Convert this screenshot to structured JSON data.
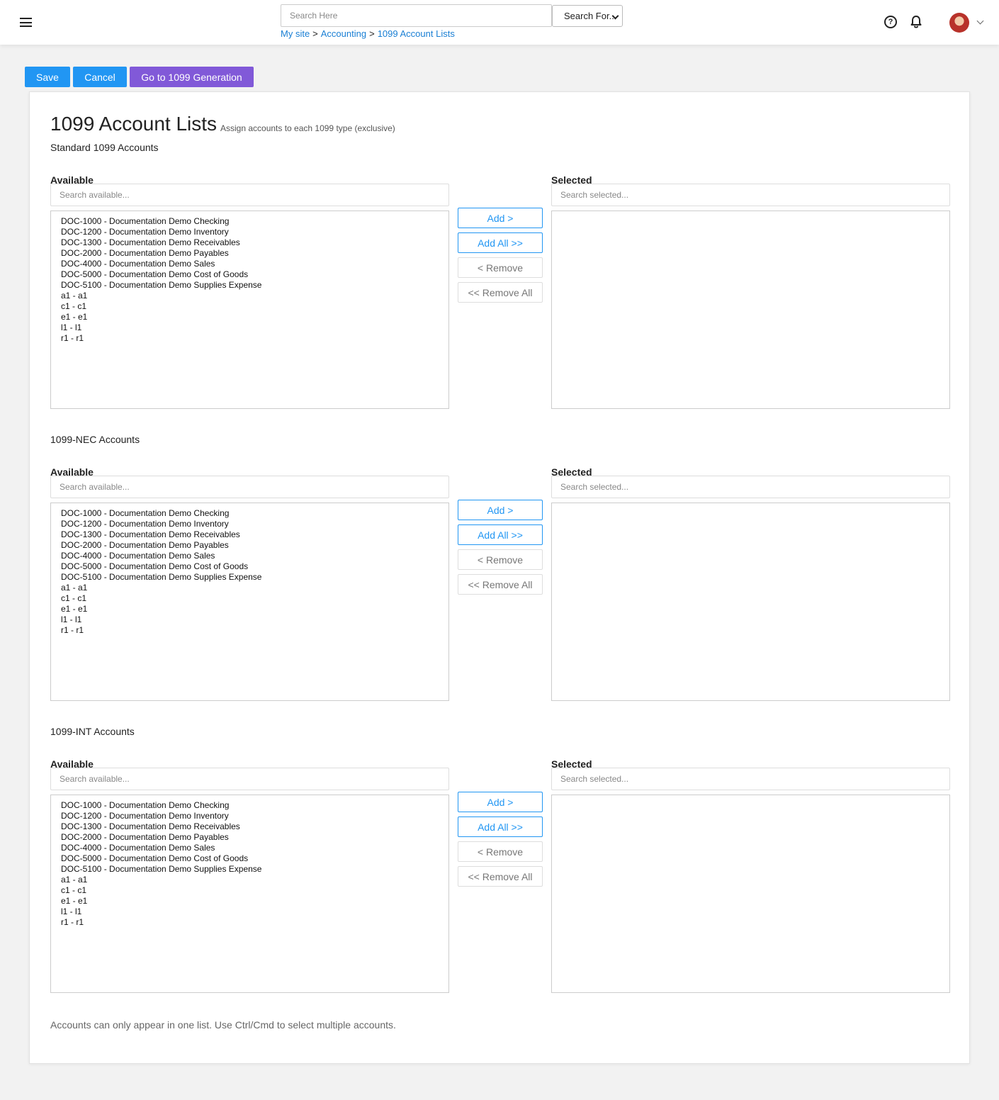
{
  "header": {
    "search_placeholder": "Search Here",
    "search_for_label": "Search For...",
    "breadcrumb": [
      "My site",
      "Accounting",
      "1099 Account Lists"
    ],
    "breadcrumb_sep": ">",
    "help_glyph": "?"
  },
  "toolbar": {
    "save_label": "Save",
    "cancel_label": "Cancel",
    "generation_label": "Go to 1099 Generation"
  },
  "page": {
    "title": "1099 Account Lists",
    "subtitle": "Assign accounts to each 1099 type (exclusive)",
    "footnote": "Accounts can only appear in one list. Use Ctrl/Cmd to select multiple accounts."
  },
  "common": {
    "available_label": "Available",
    "selected_label": "Selected",
    "available_placeholder": "Search available...",
    "selected_placeholder": "Search selected...",
    "add_label": "Add >",
    "add_all_label": "Add All >>",
    "remove_label": "< Remove",
    "remove_all_label": "<< Remove All"
  },
  "sections": [
    {
      "title": "Standard 1099 Accounts",
      "available": [
        "DOC-1000 - Documentation Demo Checking",
        "DOC-1200 - Documentation Demo Inventory",
        "DOC-1300 - Documentation Demo Receivables",
        "DOC-2000 - Documentation Demo Payables",
        "DOC-4000 - Documentation Demo Sales",
        "DOC-5000 - Documentation Demo Cost of Goods",
        "DOC-5100 - Documentation Demo Supplies Expense",
        "a1 - a1",
        "c1 - c1",
        "e1 - e1",
        "l1 - l1",
        "r1 - r1"
      ],
      "selected": []
    },
    {
      "title": "1099-NEC Accounts",
      "available": [
        "DOC-1000 - Documentation Demo Checking",
        "DOC-1200 - Documentation Demo Inventory",
        "DOC-1300 - Documentation Demo Receivables",
        "DOC-2000 - Documentation Demo Payables",
        "DOC-4000 - Documentation Demo Sales",
        "DOC-5000 - Documentation Demo Cost of Goods",
        "DOC-5100 - Documentation Demo Supplies Expense",
        "a1 - a1",
        "c1 - c1",
        "e1 - e1",
        "l1 - l1",
        "r1 - r1"
      ],
      "selected": []
    },
    {
      "title": "1099-INT Accounts",
      "available": [
        "DOC-1000 - Documentation Demo Checking",
        "DOC-1200 - Documentation Demo Inventory",
        "DOC-1300 - Documentation Demo Receivables",
        "DOC-2000 - Documentation Demo Payables",
        "DOC-4000 - Documentation Demo Sales",
        "DOC-5000 - Documentation Demo Cost of Goods",
        "DOC-5100 - Documentation Demo Supplies Expense",
        "a1 - a1",
        "c1 - c1",
        "e1 - e1",
        "l1 - l1",
        "r1 - r1"
      ],
      "selected": []
    }
  ],
  "colors": {
    "primary": "#2196f3",
    "accent_purple": "#8159d8",
    "link": "#1a7fd4"
  },
  "icons": {
    "menu": "hamburger-menu-icon",
    "help": "help-circle-icon",
    "notifications": "bell-icon",
    "user": "user-avatar",
    "user_menu": "chevron-down-icon"
  }
}
